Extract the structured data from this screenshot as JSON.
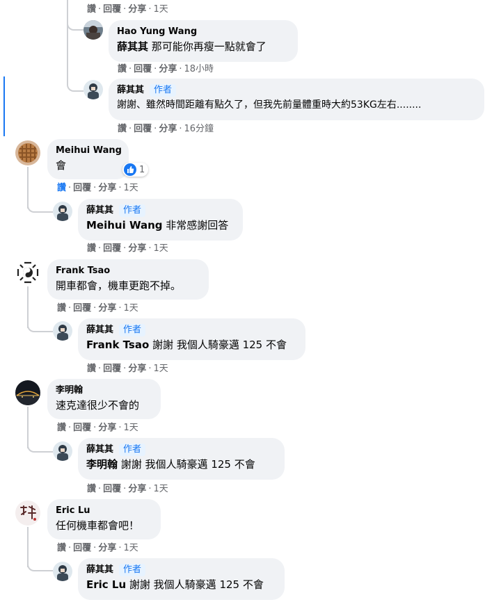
{
  "labels": {
    "like": "讚",
    "reply": "回覆",
    "share": "分享",
    "dot": "·",
    "author": "作者"
  },
  "colors": {
    "accent": "#1877f2",
    "bubble": "#f0f2f5",
    "meta": "#65676b",
    "thread_line": "#ced0d4"
  },
  "thread0": {
    "top_actions": {
      "time": "1天"
    },
    "r1": {
      "name": "Hao Yung Wang",
      "mention": "薛其其",
      "text": " 那可能你再瘦一點就會了",
      "time": "18小時"
    },
    "r2": {
      "name": "薛其其",
      "text": "謝謝、雖然時間距離有點久了，但我先前量體重時大約53KG左右........",
      "time": "16分鐘"
    }
  },
  "comments": [
    {
      "name": "Meihui Wang",
      "text": "會",
      "time": "1天",
      "reaction_count": "1",
      "reply": {
        "name": "薛其其",
        "mention": "Meihui Wang",
        "text": " 非常感謝回答",
        "time": "1天"
      }
    },
    {
      "name": "Frank Tsao",
      "text": "開車都會，機車更跑不掉。",
      "time": "1天",
      "reply": {
        "name": "薛其其",
        "mention": "Frank Tsao",
        "text": " 謝謝 我個人騎豪邁 125 不會",
        "time": "1天"
      }
    },
    {
      "name": "李明翰",
      "text": "速克達很少不會的",
      "time": "1天",
      "reply": {
        "name": "薛其其",
        "mention": "李明翰",
        "text": " 謝謝 我個人騎豪邁 125 不會",
        "time": "1天"
      }
    },
    {
      "name": "Eric Lu",
      "text": "任何機車都會吧！",
      "time": "1天",
      "reply": {
        "name": "薛其其",
        "mention": "Eric Lu",
        "text": " 謝謝 我個人騎豪邁 125 不會"
      }
    }
  ]
}
